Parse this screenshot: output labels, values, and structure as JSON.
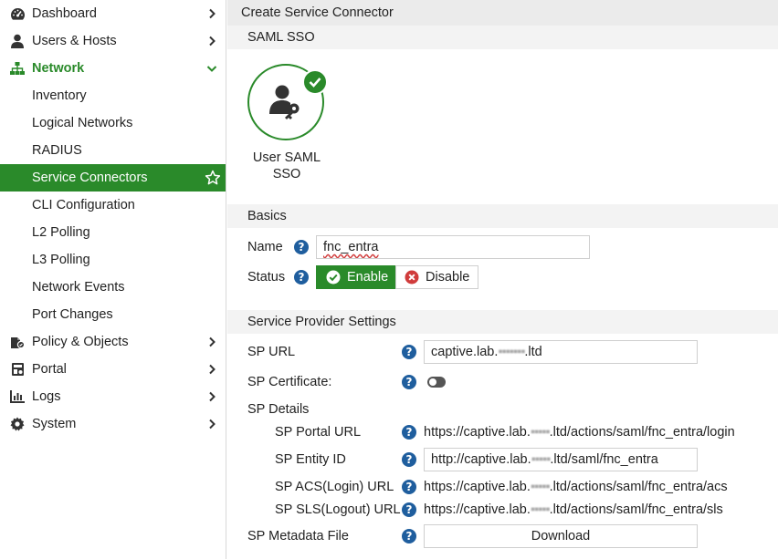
{
  "sidebar": {
    "items": [
      {
        "label": "Dashboard",
        "icon": "dashboard-icon"
      },
      {
        "label": "Users & Hosts",
        "icon": "user-icon"
      },
      {
        "label": "Network",
        "icon": "network-icon"
      },
      {
        "label": "Inventory"
      },
      {
        "label": "Logical Networks"
      },
      {
        "label": "RADIUS"
      },
      {
        "label": "Service Connectors"
      },
      {
        "label": "CLI Configuration"
      },
      {
        "label": "L2 Polling"
      },
      {
        "label": "L3 Polling"
      },
      {
        "label": "Network Events"
      },
      {
        "label": "Port Changes"
      },
      {
        "label": "Policy & Objects",
        "icon": "policy-icon"
      },
      {
        "label": "Portal",
        "icon": "portal-icon"
      },
      {
        "label": "Logs",
        "icon": "logs-icon"
      },
      {
        "label": "System",
        "icon": "gear-icon"
      }
    ]
  },
  "main": {
    "title": "Create Service Connector",
    "saml_section": "SAML SSO",
    "saml_card_label": "User SAML SSO",
    "basics_section": "Basics",
    "name_label": "Name",
    "name_value": "fnc_entra",
    "status_label": "Status",
    "enable_label": "Enable",
    "disable_label": "Disable",
    "sp_section": "Service Provider Settings",
    "sp_url_label": "SP URL",
    "sp_url_prefix": "captive.lab.",
    "sp_url_suffix": ".ltd",
    "sp_cert_label": "SP Certificate:",
    "sp_details_label": "SP Details",
    "sp_portal_label": "SP Portal URL",
    "sp_portal_prefix": "https://captive.lab.",
    "sp_portal_suffix": ".ltd/actions/saml/fnc_entra/login",
    "sp_entity_label": "SP Entity ID",
    "sp_entity_prefix": "http://captive.lab.",
    "sp_entity_suffix": ".ltd/saml/fnc_entra",
    "sp_acs_label": "SP ACS(Login) URL",
    "sp_acs_prefix": "https://captive.lab.",
    "sp_acs_suffix": ".ltd/actions/saml/fnc_entra/acs",
    "sp_sls_label": "SP SLS(Logout) URL",
    "sp_sls_prefix": "https://captive.lab.",
    "sp_sls_suffix": ".ltd/actions/saml/fnc_entra/sls",
    "sp_metadata_label": "SP Metadata File",
    "download_label": "Download",
    "help_glyph": "?"
  },
  "colors": {
    "accent": "#2a8a2a",
    "help": "#1f5e9e",
    "danger": "#d03b3b"
  }
}
